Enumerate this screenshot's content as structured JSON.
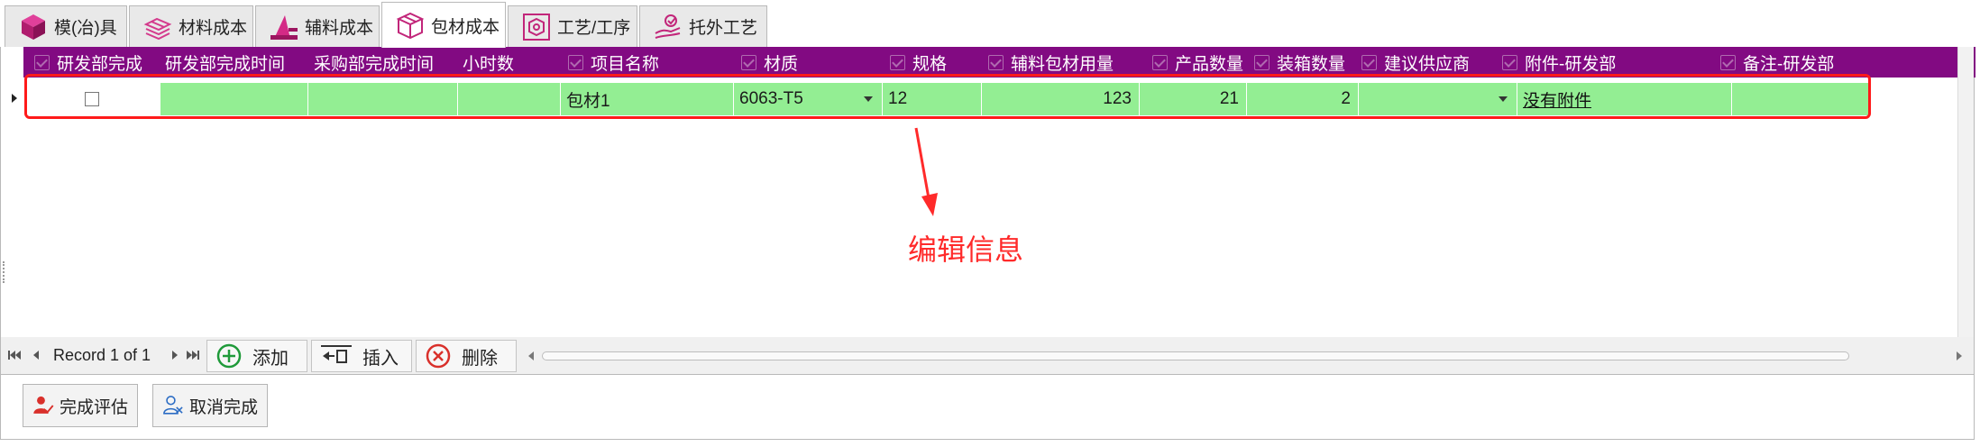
{
  "tabs": [
    {
      "label": "模(冶)具",
      "icon": "cube-icon",
      "active": false
    },
    {
      "label": "材料成本",
      "icon": "material-stack-icon",
      "active": false
    },
    {
      "label": "辅料成本",
      "icon": "cone-stack-icon",
      "active": false
    },
    {
      "label": "包材成本",
      "icon": "box-icon",
      "active": true
    },
    {
      "label": "工艺/工序",
      "icon": "process-icon",
      "active": false
    },
    {
      "label": "托外工艺",
      "icon": "outsource-hand-icon",
      "active": false
    }
  ],
  "grid": {
    "columns": [
      "研发部完成",
      "研发部完成时间",
      "采购部完成时间",
      "小时数",
      "项目名称",
      "材质",
      "规格",
      "辅料包材用量",
      "产品数量",
      "装箱数量",
      "建议供应商",
      "附件-研发部",
      "备注-研发部"
    ],
    "row": {
      "completed": false,
      "rd_done_time": "",
      "purchase_done_time": "",
      "hours": "",
      "project_name": "包材1",
      "material": "6063-T5",
      "spec": "12",
      "usage": "123",
      "product_qty": "21",
      "pack_qty": "2",
      "supplier": "",
      "attachment": "没有附件",
      "remark": ""
    }
  },
  "annotation": {
    "text": "编辑信息",
    "color": "#ff2a2a"
  },
  "navigator": {
    "record_text": "Record 1 of 1",
    "add_label": "添加",
    "insert_label": "插入",
    "delete_label": "删除"
  },
  "toolbar": {
    "complete_label": "完成评估",
    "cancel_label": "取消完成"
  },
  "colors": {
    "header": "#820a82",
    "row": "#93ee93",
    "highlight": "#ff1a1a"
  }
}
